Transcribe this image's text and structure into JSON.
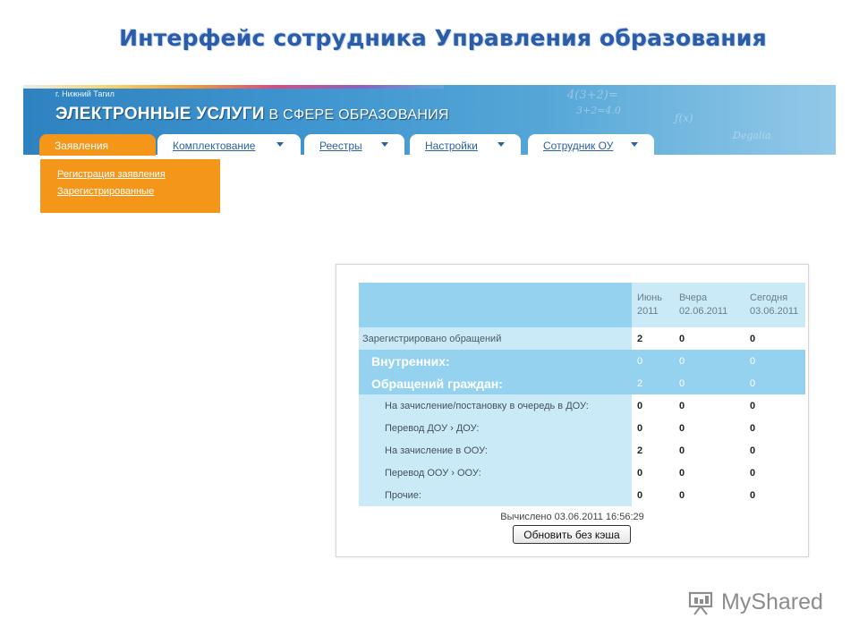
{
  "slide": {
    "title": "Интерфейс сотрудника Управления образования"
  },
  "banner": {
    "city": "г. Нижний Тагил",
    "brand_bold": "ЭЛЕКТРОННЫЕ УСЛУГИ",
    "brand_rest": " В СФЕРЕ ОБРАЗОВАНИЯ"
  },
  "nav": {
    "tabs": [
      {
        "label": "Заявления",
        "active": true
      },
      {
        "label": "Комплектование"
      },
      {
        "label": "Реестры"
      },
      {
        "label": "Настройки"
      },
      {
        "label": "Сотрудник ОУ"
      }
    ],
    "dropdown": [
      "Регистрация заявления",
      "Зарегистрированные"
    ]
  },
  "stats": {
    "columns": [
      "Июнь 2011",
      "Вчера 02.06.2011",
      "Сегодня 03.06.2011"
    ],
    "col_lines": [
      [
        "Июнь",
        "2011"
      ],
      [
        "Вчера",
        "02.06.2011"
      ],
      [
        "Сегодня",
        "03.06.2011"
      ]
    ],
    "rows": [
      {
        "label": "Зарегистрировано обращений",
        "values": [
          "2",
          "0",
          "0"
        ]
      },
      {
        "label": "Внутренних:",
        "values": [
          "0",
          "0",
          "0"
        ]
      },
      {
        "label": "Обращений граждан:",
        "values": [
          "2",
          "0",
          "0"
        ]
      },
      {
        "label": "На зачисление/постановку в очередь в ДОУ:",
        "values": [
          "0",
          "0",
          "0"
        ]
      },
      {
        "label": "Перевод ДОУ  › ДОУ:",
        "values": [
          "0",
          "0",
          "0"
        ]
      },
      {
        "label": "На зачисление в ООУ:",
        "values": [
          "2",
          "0",
          "0"
        ]
      },
      {
        "label": "Перевод ООУ  › ООУ:",
        "values": [
          "0",
          "0",
          "0"
        ]
      },
      {
        "label": "Прочие:",
        "values": [
          "0",
          "0",
          "0"
        ]
      }
    ],
    "computed": "Вычислено 03.06.2011 16:56:29",
    "refresh_label": "Обновить без кэша"
  },
  "watermark": {
    "text": "MyShared",
    "icon": "presentation-board-icon"
  },
  "colors": {
    "accent_orange": "#f39619",
    "table_light": "#cbeaf8",
    "table_mid": "#94d2ef",
    "title_blue": "#2a5ca8"
  }
}
